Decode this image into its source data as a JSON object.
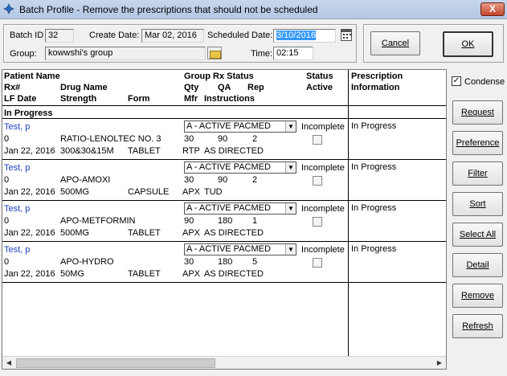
{
  "window": {
    "title": "Batch Profile - Remove the prescriptions that should not be scheduled",
    "close_glyph": "X"
  },
  "header": {
    "batch_id_label": "Batch ID",
    "batch_id_value": "32",
    "create_date_label": "Create Date:",
    "create_date_value": "Mar 02, 2016",
    "scheduled_date_label": "Scheduled Date:",
    "scheduled_date_value": "3/10/2016",
    "group_label": "Group:",
    "group_value": "kowwshi's group",
    "time_label": "Time:",
    "time_value": "02:15"
  },
  "actions": {
    "cancel": "Cancel",
    "ok": "OK"
  },
  "grid": {
    "headers": {
      "patient_name": "Patient Name",
      "rx": "Rx#",
      "lf_date": "LF Date",
      "drug_name": "Drug Name",
      "strength": "Strength",
      "form": "Form",
      "group_rx_status": "Group Rx Status",
      "qty": "Qty",
      "qa": "QA",
      "rep": "Rep",
      "mfr": "Mfr",
      "instructions": "Instructions",
      "status": "Status",
      "active": "Active",
      "prescription": "Prescription",
      "information": "Information"
    },
    "section": "In Progress",
    "rows": [
      {
        "patient": "Test, p",
        "rx": "0",
        "lf_date": "Jan 22, 2016",
        "drug": "RATIO-LENOLTEC NO. 3",
        "strength": "300&30&15M",
        "form": "TABLET",
        "group_status": "A - ACTIVE PACMED",
        "qty": "30",
        "qa": "90",
        "rep": "2",
        "mfr": "RTP",
        "instructions": "AS DIRECTED",
        "status": "Incomplete",
        "info": "In Progress"
      },
      {
        "patient": "Test, p",
        "rx": "0",
        "lf_date": "Jan 22, 2016",
        "drug": "APO-AMOXI",
        "strength": "500MG",
        "form": "CAPSULE",
        "group_status": "A - ACTIVE PACMED",
        "qty": "30",
        "qa": "90",
        "rep": "2",
        "mfr": "APX",
        "instructions": "TUD",
        "status": "Incomplete",
        "info": "In Progress"
      },
      {
        "patient": "Test, p",
        "rx": "0",
        "lf_date": "Jan 22, 2016",
        "drug": "APO-METFORMIN",
        "strength": "500MG",
        "form": "TABLET",
        "group_status": "A - ACTIVE PACMED",
        "qty": "90",
        "qa": "180",
        "rep": "1",
        "mfr": "APX",
        "instructions": "AS DIRECTED",
        "status": "Incomplete",
        "info": "In Progress"
      },
      {
        "patient": "Test, p",
        "rx": "0",
        "lf_date": "Jan 22, 2016",
        "drug": "APO-HYDRO",
        "strength": "50MG",
        "form": "TABLET",
        "group_status": "A - ACTIVE PACMED",
        "qty": "30",
        "qa": "180",
        "rep": "5",
        "mfr": "APX",
        "instructions": "AS DIRECTED",
        "status": "Incomplete",
        "info": "In Progress"
      }
    ]
  },
  "side": {
    "condense_label": "Condense",
    "condense_checked": true,
    "buttons": [
      "Request",
      "Preference",
      "Filter",
      "Sort",
      "Select All",
      "Detail",
      "Remove",
      "Refresh"
    ]
  },
  "colors": {
    "link": "#1a3fbf",
    "selection": "#3399ff",
    "close": "#c2452c"
  },
  "icons": [
    "app-icon",
    "close-icon",
    "calendar-icon",
    "folder-icon",
    "dropdown-arrow-icon",
    "scroll-left-icon",
    "scroll-right-icon"
  ]
}
